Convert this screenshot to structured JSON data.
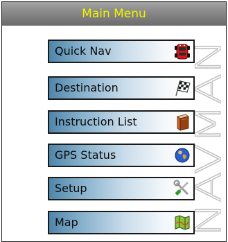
{
  "header": {
    "title": "Main Menu"
  },
  "brand": {
    "watermark": "NAVMAN"
  },
  "menu": {
    "items": [
      {
        "label": "Quick Nav",
        "icon": "car-icon"
      },
      {
        "label": "Destination",
        "icon": "checkered-flag-icon"
      },
      {
        "label": "Instruction List",
        "icon": "book-icon"
      },
      {
        "label": "GPS Status",
        "icon": "globe-icon"
      },
      {
        "label": "Setup",
        "icon": "tools-icon"
      },
      {
        "label": "Map",
        "icon": "map-icon"
      }
    ]
  },
  "colors": {
    "title_text": "#f2f200",
    "title_bar": "#8a8a8a",
    "button_left": "#4f86aa"
  }
}
